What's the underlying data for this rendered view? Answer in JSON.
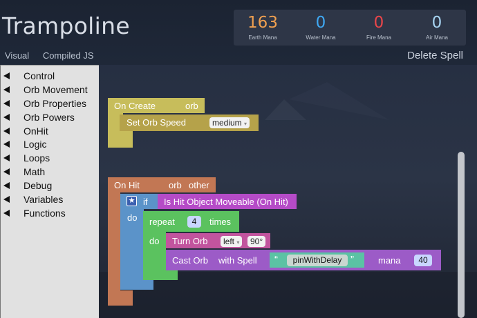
{
  "app": {
    "title": "Trampoline"
  },
  "mana": [
    {
      "value": "163",
      "label": "Earth Mana",
      "color": "#f0a050"
    },
    {
      "value": "0",
      "label": "Water Mana",
      "color": "#3fa8f2"
    },
    {
      "value": "0",
      "label": "Fire Mana",
      "color": "#e9464a"
    },
    {
      "value": "0",
      "label": "Air Mana",
      "color": "#a7d4f2"
    }
  ],
  "tabs": [
    "Visual",
    "Compiled JS"
  ],
  "delete_label": "Delete Spell",
  "toolbox": [
    "Control",
    "Orb Movement",
    "Orb Properties",
    "Orb Powers",
    "OnHit",
    "Logic",
    "Loops",
    "Math",
    "Debug",
    "Variables",
    "Functions"
  ],
  "blocks": {
    "on_create": {
      "label": "On Create",
      "param": "orb",
      "color": "#c7bd5b"
    },
    "set_speed": {
      "label": "Set Orb Speed",
      "value": "medium",
      "color": "#b5a24a"
    },
    "on_hit": {
      "label": "On Hit",
      "param1": "orb",
      "param2": "other",
      "color": "#c27754"
    },
    "if_block": {
      "if_label": "if",
      "do_label": "do",
      "color": "#5b93c9"
    },
    "is_hit": {
      "label": "Is Hit Object Moveable (On Hit)",
      "color": "#b54bc7"
    },
    "repeat": {
      "label": "repeat",
      "count": "4",
      "times": "times",
      "do_label": "do",
      "color": "#5bc25f"
    },
    "turn": {
      "label": "Turn Orb",
      "dir": "left",
      "angle": "90°",
      "color": "#c2549e"
    },
    "cast": {
      "label": "Cast Orb",
      "with": "with Spell",
      "spell": "pinWithDelay",
      "mana_label": "mana",
      "mana": "40",
      "color": "#9c5bc7",
      "spell_color": "#5bc2a4"
    }
  }
}
